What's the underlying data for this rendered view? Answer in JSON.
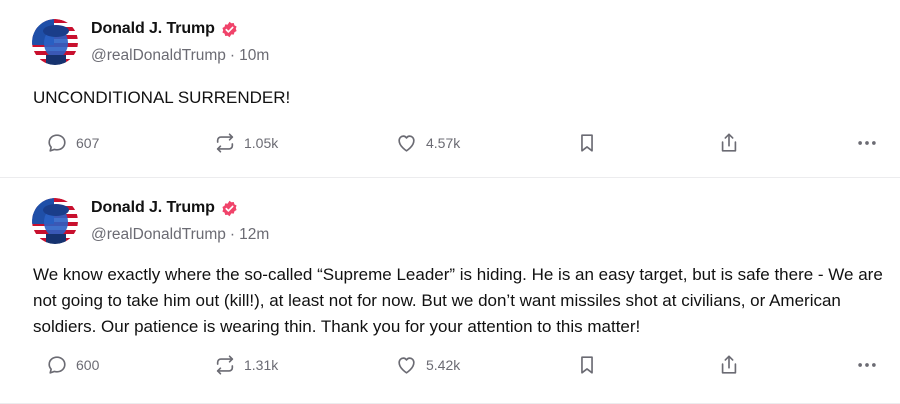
{
  "posts": [
    {
      "author": "Donald J. Trump",
      "handle": "@realDonaldTrump",
      "separator": "·",
      "time": "10m",
      "text": "UNCONDITIONAL SURRENDER!",
      "replies": "607",
      "restates": "1.05k",
      "likes": "4.57k"
    },
    {
      "author": "Donald J. Trump",
      "handle": "@realDonaldTrump",
      "separator": "·",
      "time": "12m",
      "text": "We know exactly where the so-called “Supreme Leader” is hiding. He is an easy target, but is safe there - We are not going to take him out (kill!), at least not for now. But we don’t want missiles shot at civilians, or American soldiers. Our patience is wearing thin. Thank you for your attention to this matter!",
      "replies": "600",
      "restates": "1.31k",
      "likes": "5.42k"
    }
  ],
  "icons": {
    "reply": "speech-bubble-icon",
    "restate": "repost-arrows-icon",
    "like": "heart-icon",
    "bookmark": "bookmark-icon",
    "share": "share-upload-icon",
    "more": "more-dots-icon",
    "verified": "verified-badge-icon"
  },
  "colors": {
    "verified": "#f0436a",
    "muted": "#6b6b73",
    "text": "#111111"
  }
}
